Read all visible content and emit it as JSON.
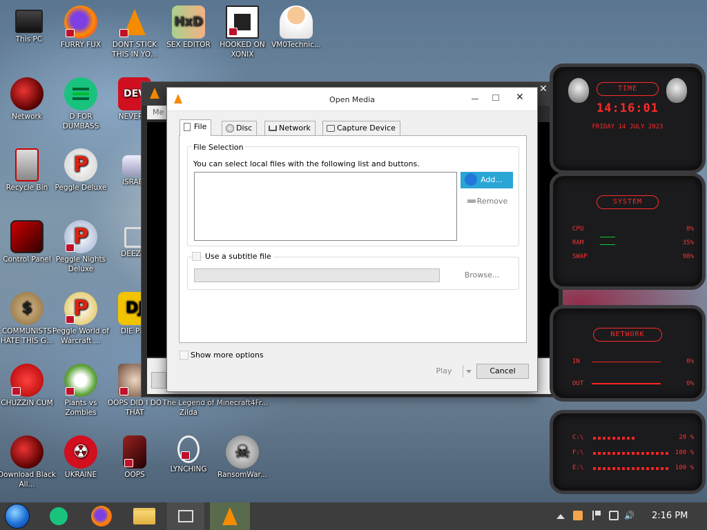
{
  "desktop": {
    "icons": [
      {
        "label": "This PC"
      },
      {
        "label": "FURRY FUX"
      },
      {
        "label": "DONT STICK THIS IN YO..."
      },
      {
        "label": "SEX EDITOR"
      },
      {
        "label": "HOOKED ON XONIX"
      },
      {
        "label": "VM0Technic..."
      },
      {
        "label": "Network"
      },
      {
        "label": "D FOR DUMBASS"
      },
      {
        "label": "NEVER U"
      },
      {
        "label": "Recycle Bin"
      },
      {
        "label": "Peggle Deluxe"
      },
      {
        "label": "ISRAEL"
      },
      {
        "label": "Control Panel"
      },
      {
        "label": "Peggle Nights Deluxe"
      },
      {
        "label": "DEEZ N"
      },
      {
        "label": "COMMUNISTS HATE THIS G..."
      },
      {
        "label": "Peggle World of Warcraft ..."
      },
      {
        "label": "DIE PLE"
      },
      {
        "label": "CHUZZIN CUM"
      },
      {
        "label": "Plants vs Zombies"
      },
      {
        "label": "OOPS DID I DO THAT"
      },
      {
        "label": "The Legend of Zilda"
      },
      {
        "label": "Minecraft4Fr..."
      },
      {
        "label": "Download Black All..."
      },
      {
        "label": "UKRAINE"
      },
      {
        "label": "OOPS"
      },
      {
        "label": "LYNCHING"
      },
      {
        "label": "RansomWar..."
      }
    ]
  },
  "vlc_main": {
    "menu_stub": "Me"
  },
  "dialog": {
    "title": "Open Media",
    "tabs": [
      {
        "label": "File"
      },
      {
        "label": "Disc"
      },
      {
        "label": "Network"
      },
      {
        "label": "Capture Device"
      }
    ],
    "file_selection": {
      "group_label": "File Selection",
      "description": "You can select local files with the following list and buttons.",
      "add_label": "Add...",
      "remove_label": "Remove"
    },
    "subtitle": {
      "checkbox_label": "Use a subtitle file",
      "browse_label": "Browse..."
    },
    "show_more_label": "Show more options",
    "play_label": "Play",
    "cancel_label": "Cancel"
  },
  "widgets": {
    "clock": {
      "title": "TIME",
      "time": "14:16:01",
      "date": "FRIDAY 14 JULY 2023"
    },
    "system": {
      "title": "SYSTEM",
      "rows": [
        {
          "label": "CPU",
          "value": "8%"
        },
        {
          "label": "RAM",
          "value": "35%"
        },
        {
          "label": "SWAP",
          "value": "98%"
        }
      ]
    },
    "network": {
      "title": "NETWORK",
      "rows": [
        {
          "label": "IN",
          "value": "0%"
        },
        {
          "label": "OUT",
          "value": "0%"
        }
      ]
    },
    "drives": {
      "rows": [
        {
          "label": "C:\\",
          "value": "28 %"
        },
        {
          "label": "F:\\",
          "value": "100 %"
        },
        {
          "label": "E:\\",
          "value": "100 %"
        }
      ]
    }
  },
  "taskbar": {
    "clock": "2:16 PM"
  },
  "colors": {
    "accent": "#29a5d6",
    "widget_red": "#ff2a2a",
    "taskbar": "#3d3d3d"
  }
}
